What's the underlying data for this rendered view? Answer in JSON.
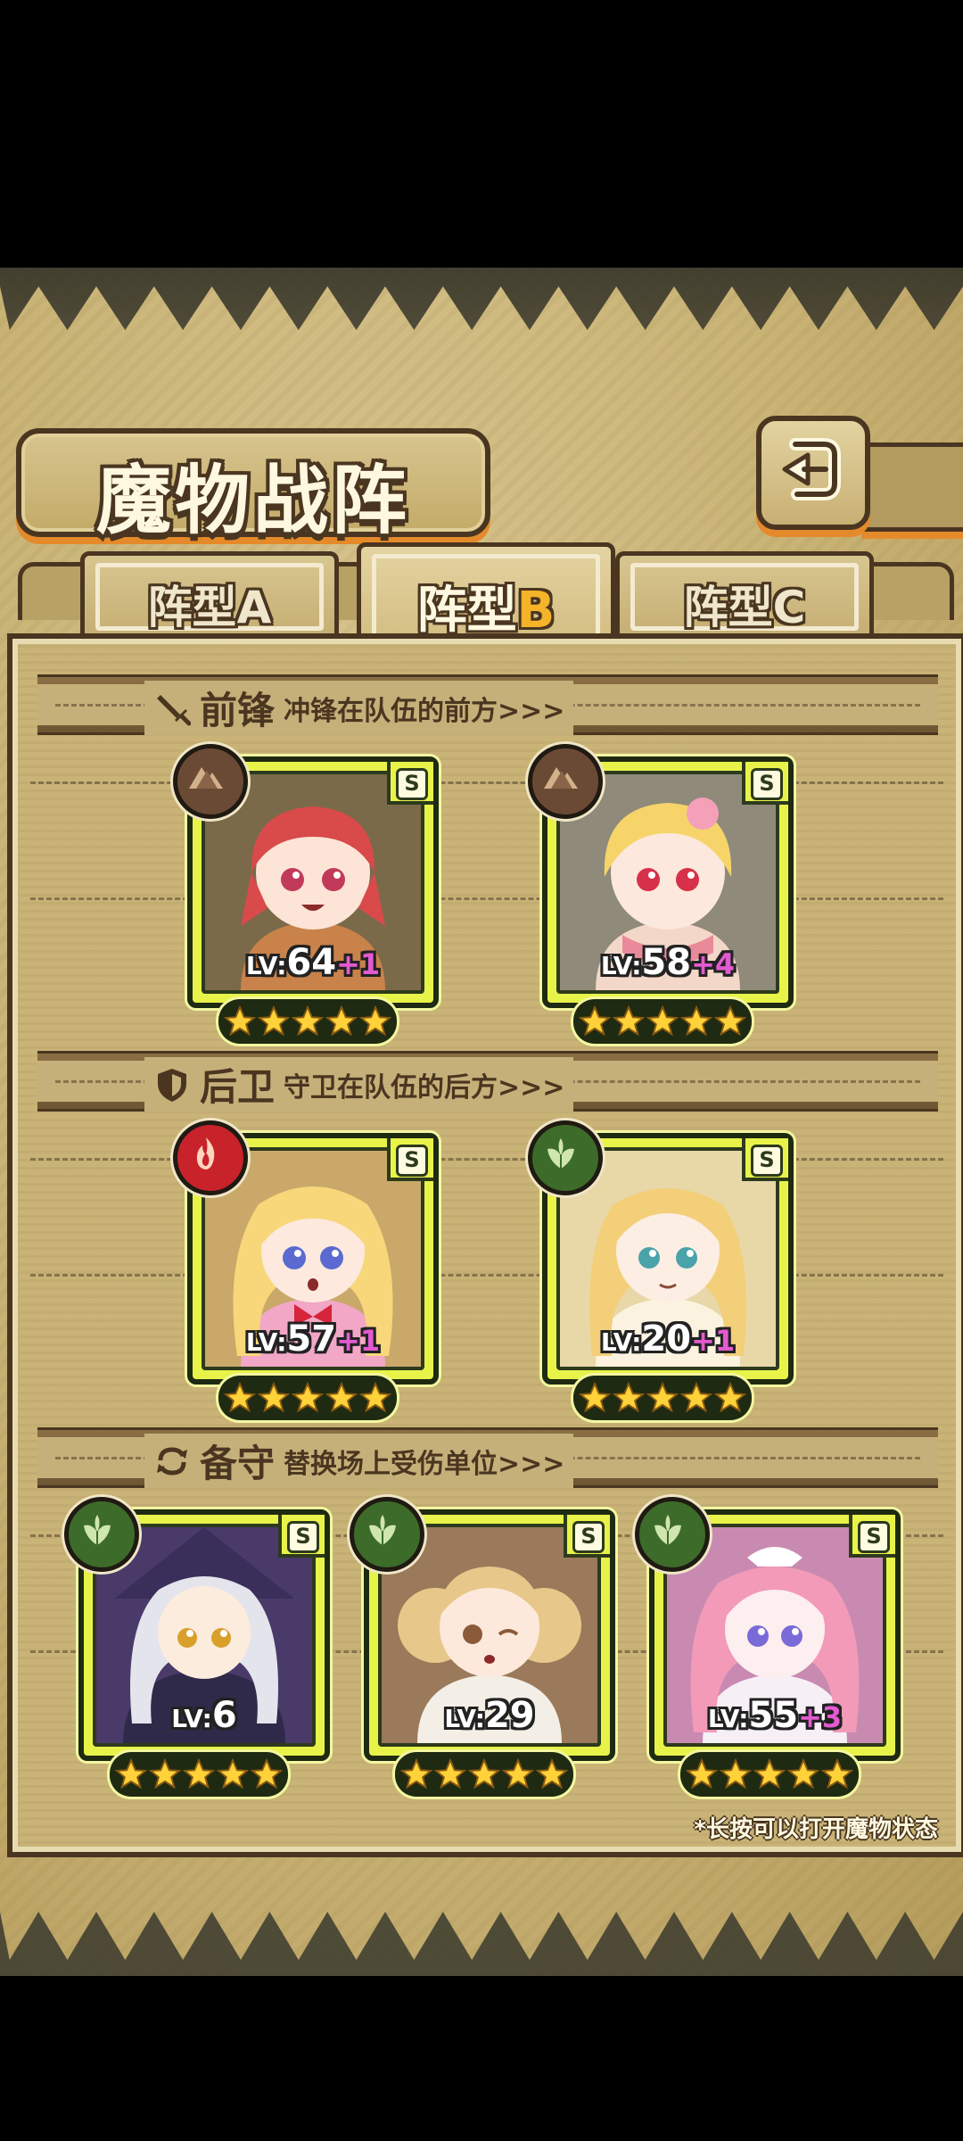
{
  "screen": {
    "title": "魔物战阵"
  },
  "tabs": [
    {
      "label_main": "阵型",
      "label_suffix": "A",
      "active": false
    },
    {
      "label_main": "阵型",
      "label_suffix": "B",
      "active": true
    },
    {
      "label_main": "阵型",
      "label_suffix": "C",
      "active": false
    }
  ],
  "sections": {
    "front": {
      "title": "前锋",
      "desc": "冲锋在队伍的前方>>>"
    },
    "rear": {
      "title": "后卫",
      "desc": "守卫在队伍的后方>>>"
    },
    "reserve": {
      "title": "备守",
      "desc": "替换场上受伤单位>>>"
    }
  },
  "cards": {
    "front_1": {
      "level_prefix": "LV:",
      "level": "64",
      "plus": "+1",
      "grade": "S",
      "element": "earth",
      "stars": 5
    },
    "front_2": {
      "level_prefix": "LV:",
      "level": "58",
      "plus": "+4",
      "grade": "S",
      "element": "earth",
      "stars": 5
    },
    "rear_1": {
      "level_prefix": "LV:",
      "level": "57",
      "plus": "+1",
      "grade": "S",
      "element": "fire",
      "stars": 5
    },
    "rear_2": {
      "level_prefix": "LV:",
      "level": "20",
      "plus": "+1",
      "grade": "S",
      "element": "wood",
      "stars": 5
    },
    "reserve_1": {
      "level_prefix": "LV:",
      "level": "6",
      "plus": "",
      "grade": "S",
      "element": "wood",
      "stars": 5
    },
    "reserve_2": {
      "level_prefix": "LV:",
      "level": "29",
      "plus": "",
      "grade": "S",
      "element": "wood",
      "stars": 5
    },
    "reserve_3": {
      "level_prefix": "LV:",
      "level": "55",
      "plus": "+3",
      "grade": "S",
      "element": "wood",
      "stars": 5
    }
  },
  "footnote": "*长按可以打开魔物状态",
  "colors": {
    "card_frame": "#e8f34a",
    "fire": "#c8222a",
    "wood": "#3d6b2a",
    "earth": "#6b4a35",
    "plus_text": "#e35ad0",
    "accent": "#e58a2a"
  }
}
